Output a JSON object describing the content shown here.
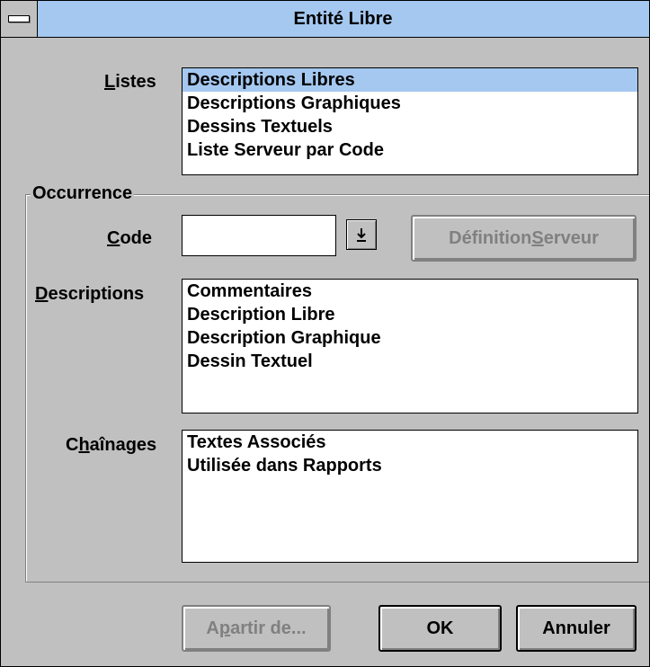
{
  "window": {
    "title": "Entité Libre"
  },
  "listes": {
    "label_mn": "L",
    "label_rest": "istes",
    "items": [
      "Descriptions Libres",
      "Descriptions Graphiques",
      "Dessins Textuels",
      "Liste Serveur par Code"
    ],
    "selected_index": 0
  },
  "occurrence": {
    "label": "Occurrence",
    "code": {
      "label_mn": "C",
      "label_rest": "ode",
      "value": "",
      "dropdown_icon": "down-arrow-icon"
    },
    "def_serveur_pre": "Définition ",
    "def_serveur_mn": "S",
    "def_serveur_post": "erveur",
    "descriptions": {
      "label_mn": "D",
      "label_rest": "escriptions",
      "items": [
        "Commentaires",
        "Description Libre",
        "Description Graphique",
        "Dessin Textuel"
      ]
    },
    "chainages": {
      "label_pre": "C",
      "label_mn": "h",
      "label_post": "aînages",
      "items": [
        "Textes Associés",
        "Utilisée dans Rapports"
      ]
    }
  },
  "buttons": {
    "apartir_pre": "A ",
    "apartir_mn": "p",
    "apartir_post": "artir de...",
    "ok": "OK",
    "annuler": "Annuler"
  },
  "colors": {
    "title_bg": "#a4c8f0",
    "dialog_bg": "#c0c0c0",
    "selection": "#a4c8f0"
  }
}
